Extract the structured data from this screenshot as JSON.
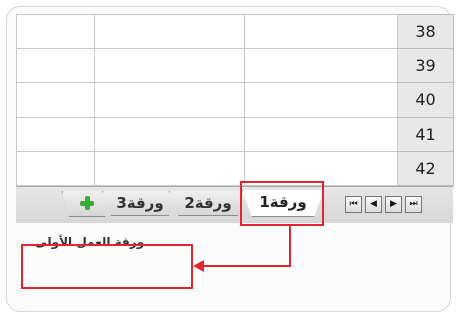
{
  "rows": [
    "38",
    "39",
    "40",
    "41",
    "42"
  ],
  "tabs": {
    "sheet1": "ورقة1",
    "sheet2": "ورقة2",
    "sheet3": "ورقة3"
  },
  "nav_icons": [
    "first-sheet-icon",
    "prev-sheet-icon",
    "next-sheet-icon",
    "last-sheet-icon"
  ],
  "nav_glyphs": {
    "first": "⏮",
    "prev": "◀",
    "next": "▶",
    "last": "⏭"
  },
  "label": "ورقة العمل الأولى",
  "colors": {
    "highlight": "#e0262e",
    "add_icon": "#3ba83a"
  }
}
